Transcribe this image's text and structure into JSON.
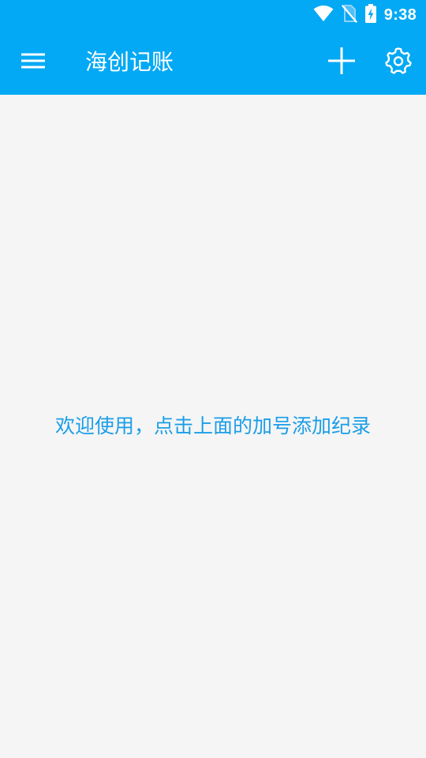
{
  "status_bar": {
    "time": "9:38",
    "icons": [
      "wifi-icon",
      "no-sim-icon",
      "battery-charging-icon"
    ]
  },
  "toolbar": {
    "title": "海创记账",
    "menu_icon": "hamburger-menu-icon",
    "add_icon": "plus-icon",
    "settings_icon": "gear-icon"
  },
  "main": {
    "empty_message": "欢迎使用，点击上面的加号添加纪录"
  },
  "colors": {
    "primary": "#03a9f4",
    "background": "#f5f5f5",
    "message_text": "#1a9ee8"
  }
}
